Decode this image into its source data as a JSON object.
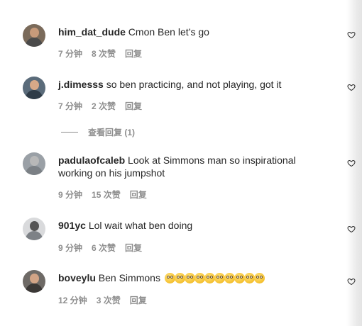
{
  "comments": [
    {
      "username": "him_dat_dude",
      "text": "Cmon Ben let’s go",
      "time": "7 分钟",
      "likes": "8 次赞",
      "reply": "回复",
      "avatar_color": "#7a6a5a"
    },
    {
      "username": "j.dimesss",
      "text": "so ben practicing, and not playing, got it",
      "time": "7 分钟",
      "likes": "2 次赞",
      "reply": "回复",
      "avatar_color": "#5a6b7a",
      "view_replies": "查看回复 (1)"
    },
    {
      "username": "padulaofcaleb",
      "text": "Look at Simmons man so inspirational working on his jumpshot",
      "time": "9 分钟",
      "likes": "15 次赞",
      "reply": "回复",
      "avatar_color": "#9aa0a6"
    },
    {
      "username": "901yc",
      "text": "Lol wait what ben doing",
      "time": "9 分钟",
      "likes": "6 次赞",
      "reply": "回复",
      "avatar_color": "#b5b8bc"
    },
    {
      "username": "boveylu",
      "text": "Ben Simmons",
      "emoji_count": 10,
      "emoji": "flushed-face-emoji",
      "time": "12 分钟",
      "likes": "3 次赞",
      "reply": "回复",
      "avatar_color": "#6e6a66"
    }
  ],
  "icons": {
    "like": "heart-outline-icon"
  },
  "colors": {
    "text": "#262626",
    "meta": "#8e8e8e",
    "background": "#ffffff"
  }
}
